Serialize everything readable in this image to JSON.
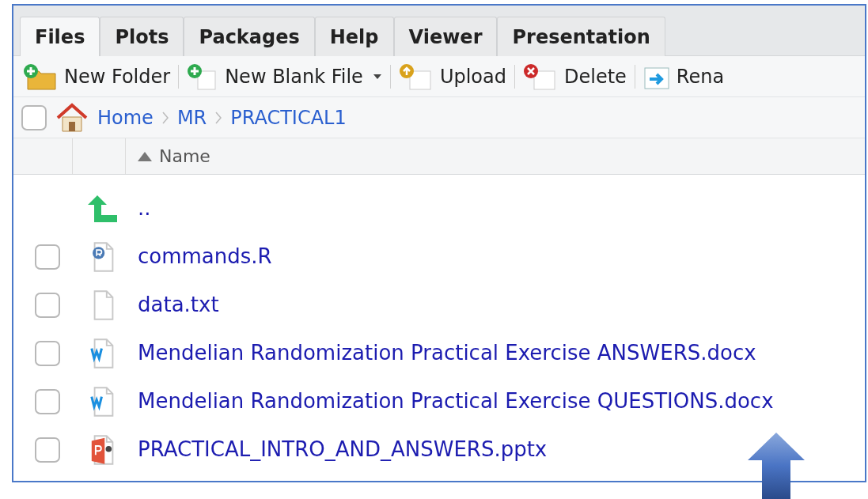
{
  "tabs": [
    {
      "label": "Files",
      "selected": true
    },
    {
      "label": "Plots",
      "selected": false
    },
    {
      "label": "Packages",
      "selected": false
    },
    {
      "label": "Help",
      "selected": false
    },
    {
      "label": "Viewer",
      "selected": false
    },
    {
      "label": "Presentation",
      "selected": false
    }
  ],
  "toolbar": [
    {
      "kind": "new_folder",
      "label": "New Folder",
      "dropdown": false
    },
    {
      "kind": "new_file",
      "label": "New Blank File",
      "dropdown": true
    },
    {
      "kind": "upload",
      "label": "Upload",
      "dropdown": false
    },
    {
      "kind": "delete",
      "label": "Delete",
      "dropdown": false
    },
    {
      "kind": "rename",
      "label": "Rena",
      "dropdown": false
    }
  ],
  "breadcrumb": {
    "checked": false,
    "items": [
      "Home",
      "MR",
      "PRACTICAL1"
    ]
  },
  "table": {
    "columns": [
      "Name"
    ],
    "rows": [
      {
        "kind": "parent",
        "name": ".."
      },
      {
        "kind": "r",
        "name": "commands.R",
        "checked": false
      },
      {
        "kind": "text",
        "name": "data.txt",
        "checked": false
      },
      {
        "kind": "word",
        "name": "Mendelian Randomization Practical Exercise ANSWERS.docx",
        "checked": false
      },
      {
        "kind": "word",
        "name": "Mendelian Randomization Practical Exercise QUESTIONS.docx",
        "checked": false
      },
      {
        "kind": "powerpoint",
        "name": "PRACTICAL_INTRO_AND_ANSWERS.pptx",
        "checked": false
      }
    ]
  }
}
